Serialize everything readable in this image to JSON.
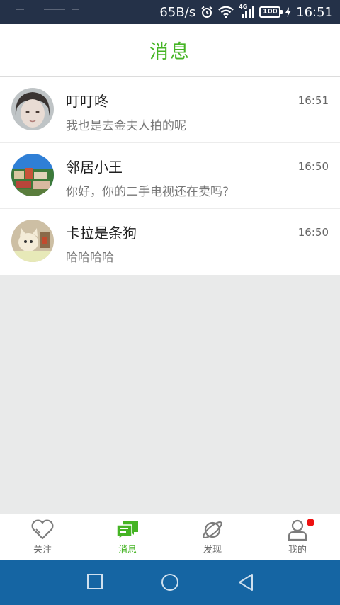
{
  "status_bar": {
    "net_speed": "65B/s",
    "network_type": "4G",
    "battery": "100",
    "time": "16:51",
    "icons": [
      "alarm-icon",
      "wifi-icon",
      "signal-icon",
      "battery-icon",
      "charging-icon"
    ]
  },
  "header": {
    "title": "消息"
  },
  "messages": [
    {
      "name": "叮叮咚",
      "preview": "我也是去金夫人拍的呢",
      "time": "16:51"
    },
    {
      "name": "邻居小王",
      "preview": "你好，你的二手电视还在卖吗?",
      "time": "16:50"
    },
    {
      "name": "卡拉是条狗",
      "preview": "哈哈哈哈",
      "time": "16:50"
    }
  ],
  "tabs": [
    {
      "label": "关注",
      "icon": "heart-icon",
      "active": false
    },
    {
      "label": "消息",
      "icon": "chat-bubble-icon",
      "active": true
    },
    {
      "label": "发现",
      "icon": "planet-icon",
      "active": false
    },
    {
      "label": "我的",
      "icon": "person-icon",
      "active": false,
      "badge": true
    }
  ],
  "nav_bar": {
    "buttons": [
      "recent-apps-icon",
      "home-icon",
      "back-icon"
    ]
  },
  "colors": {
    "accent": "#45b424",
    "status_bar": "#243148",
    "nav_bar": "#1565a3",
    "badge": "#ee1111",
    "background": "#e9eaea"
  }
}
